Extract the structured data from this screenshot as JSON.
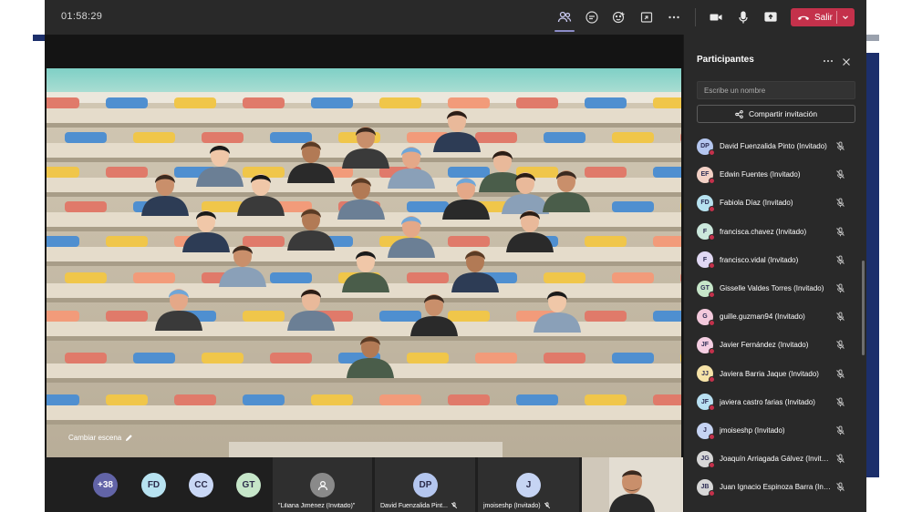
{
  "meeting": {
    "timer": "01:58:29",
    "leave_label": "Salir",
    "scene_label": "Cambiar escena"
  },
  "toolbar_icons": [
    "participants-icon",
    "chat-icon",
    "reactions-icon",
    "share-tray-icon",
    "more-icon",
    "camera-icon",
    "microphone-icon",
    "share-screen-icon"
  ],
  "panel": {
    "title": "Participantes",
    "search_placeholder": "Escribe un nombre",
    "share_label": "Compartir invitación",
    "participants": [
      {
        "initials": "DP",
        "name": "David Fuenzalida Pinto (Invitado)",
        "color": "#b4c6ef"
      },
      {
        "initials": "EF",
        "name": "Edwin Fuentes (Invitado)",
        "color": "#f3d1c6"
      },
      {
        "initials": "FD",
        "name": "Fabiola Díaz (Invitado)",
        "color": "#b7e2f0"
      },
      {
        "initials": "F",
        "name": "francisca.chavez (Invitado)",
        "color": "#cbe8dc"
      },
      {
        "initials": "F",
        "name": "francisco.vidal (Invitado)",
        "color": "#e0d8f3"
      },
      {
        "initials": "GT",
        "name": "Gisselle Valdes Torres (Invitado)",
        "color": "#c6e6c9"
      },
      {
        "initials": "G",
        "name": "guille.guzman94 (Invitado)",
        "color": "#f3c9dc"
      },
      {
        "initials": "JF",
        "name": "Javier Fernández (Invitado)",
        "color": "#f5cfe3"
      },
      {
        "initials": "JJ",
        "name": "Javiera Barria Jaque (Invitado)",
        "color": "#f6e3a8"
      },
      {
        "initials": "JF",
        "name": "javiera castro farias (Invitado)",
        "color": "#b8e0f2"
      },
      {
        "initials": "J",
        "name": "jmoiseshp (Invitado)",
        "color": "#c6d4f3"
      },
      {
        "initials": "JG",
        "name": "Joaquín Arriagada Gálvez (Invitado)",
        "color": "#d7d7d7"
      },
      {
        "initials": "JB",
        "name": "Juan Ignacio Espinoza Barra (Invitado)",
        "color": "#d7d7d7"
      }
    ]
  },
  "strip": {
    "overflow_count": "+38",
    "small_avatars": [
      {
        "initials": "FD",
        "color": "#b7e2f0"
      },
      {
        "initials": "CC",
        "color": "#c9d7f5"
      },
      {
        "initials": "GT",
        "color": "#c6e6c9"
      }
    ],
    "tiles": [
      {
        "name": "\"Liliana Jiménez (Invitado)\"",
        "initials": "",
        "color": "#9a9a9a"
      },
      {
        "name": "David Fuenzalida Pint...",
        "initials": "DP",
        "color": "#b4c6ef"
      },
      {
        "name": "jmoiseshp (Invitado)",
        "initials": "J",
        "color": "#c6d4f3"
      }
    ]
  },
  "colors": {
    "window": "#1f1f1f",
    "topbar": "#292929",
    "leave": "#c4314b",
    "accent": "#8b8cc7",
    "brand_navy": "#1c2f6b"
  }
}
